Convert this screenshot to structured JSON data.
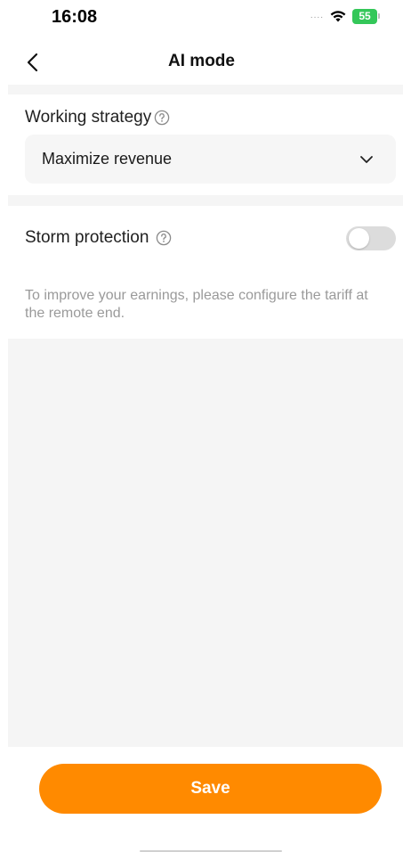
{
  "status_bar": {
    "time": "16:08",
    "signal": "....",
    "battery": "55"
  },
  "nav": {
    "title": "AI mode",
    "back_icon": "chevron-left-icon"
  },
  "strategy": {
    "label": "Working strategy",
    "selected": "Maximize revenue",
    "help_icon": "question-circle-icon",
    "dropdown_icon": "chevron-down-icon"
  },
  "storm": {
    "label": "Storm protection",
    "help_icon": "question-circle-icon",
    "enabled": false
  },
  "hint": "To improve your earnings, please configure the tariff at the remote end.",
  "footer": {
    "save_label": "Save"
  },
  "colors": {
    "accent": "#ff8a00",
    "battery": "#34c759",
    "toggle_off": "#dcdcdc",
    "section_bg": "#f5f5f5"
  }
}
